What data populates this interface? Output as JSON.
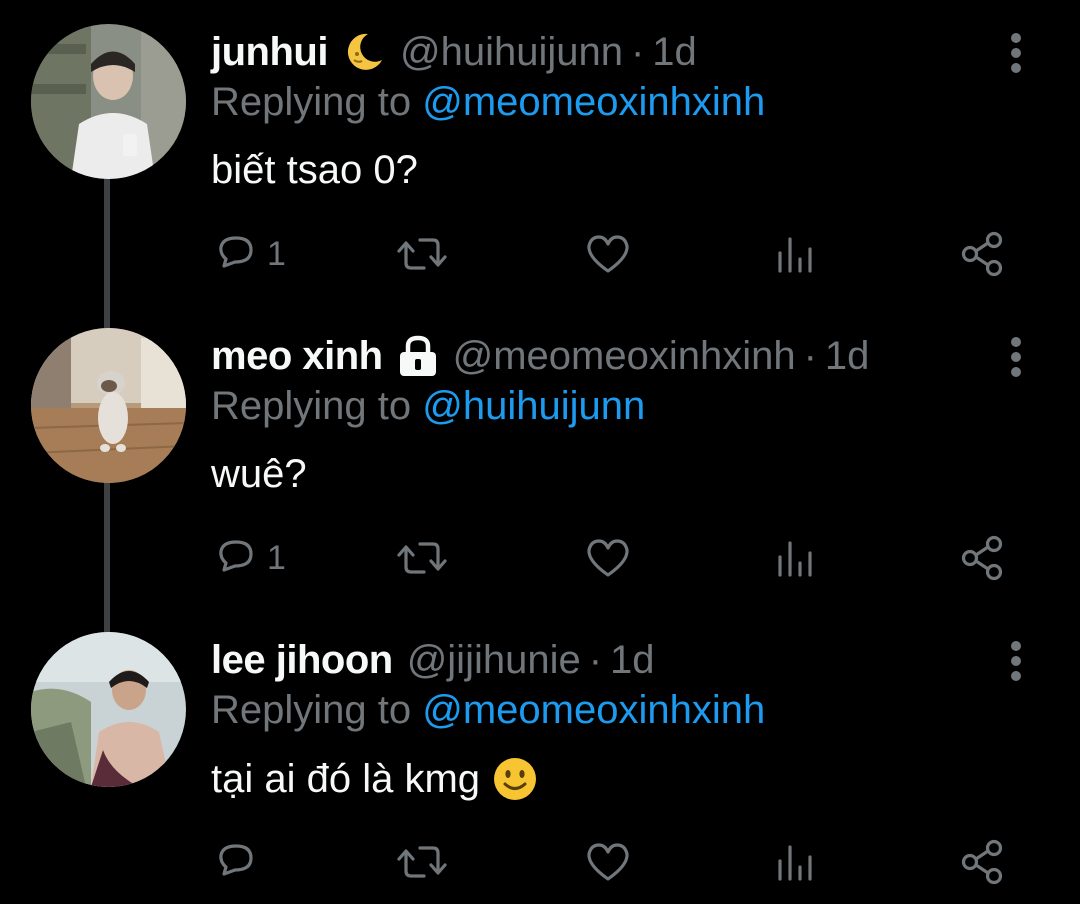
{
  "tweets": [
    {
      "name": "junhui",
      "badge": "crescent-moon-emoji",
      "handle": "@huihuijunn",
      "separator": "·",
      "time": "1d",
      "replying_prefix": "Replying to",
      "replying_to": "@meomeoxinhxinh",
      "text": "biết tsao 0?",
      "reply_count": "1",
      "retweet_count": "",
      "like_count": "",
      "view_count": ""
    },
    {
      "name": "meo xinh",
      "badge": "lock-icon",
      "handle": "@meomeoxinhxinh",
      "separator": "·",
      "time": "1d",
      "replying_prefix": "Replying to",
      "replying_to": "@huihuijunn",
      "text": "wuê?",
      "reply_count": "1",
      "retweet_count": "",
      "like_count": "",
      "view_count": ""
    },
    {
      "name": "lee jihoon",
      "badge": "",
      "handle": "@jijihunie",
      "separator": "·",
      "time": "1d",
      "replying_prefix": "Replying to",
      "replying_to": "@meomeoxinhxinh",
      "text": "tại ai đó là kmg",
      "text_emoji": "slightly-smiling-face-emoji",
      "reply_count": "",
      "retweet_count": "",
      "like_count": "",
      "view_count": ""
    }
  ],
  "colors": {
    "background": "#000000",
    "name": "#f7f9f9",
    "secondary": "#71767b",
    "mention": "#1d9bf0",
    "icon": "#71767b",
    "thread_line": "#3e4144",
    "moon": "#f5c542",
    "smiley": "#f7c531"
  },
  "icons": {
    "reply": "reply-icon",
    "retweet": "retweet-icon",
    "like": "heart-icon",
    "views": "views-icon",
    "share": "share-icon",
    "more": "more-vertical-icon"
  }
}
